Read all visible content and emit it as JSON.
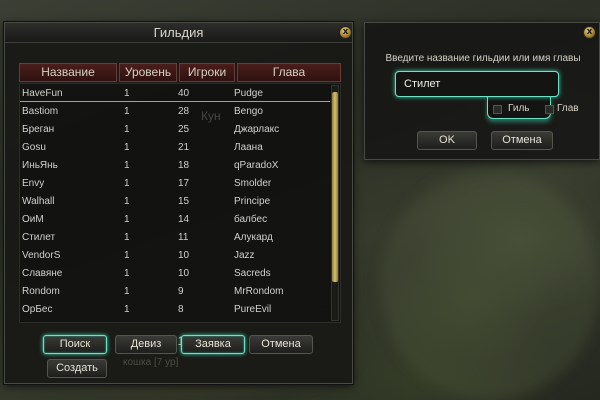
{
  "guild_window": {
    "title": "Гильдия",
    "close_label": "x",
    "columns": [
      "Название",
      "Уровень",
      "Игроки",
      "Глава"
    ],
    "rows": [
      {
        "name": "HaveFun",
        "level": "1",
        "players": "40",
        "leader": "Pudge"
      },
      {
        "name": "Bastiom",
        "level": "1",
        "players": "28",
        "leader": "Bengo"
      },
      {
        "name": "Бреган",
        "level": "1",
        "players": "25",
        "leader": "Джарлакс"
      },
      {
        "name": "Gosu",
        "level": "1",
        "players": "21",
        "leader": "Лаана"
      },
      {
        "name": "ИньЯнь",
        "level": "1",
        "players": "18",
        "leader": "qParadoX"
      },
      {
        "name": "Envy",
        "level": "1",
        "players": "17",
        "leader": "Smolder"
      },
      {
        "name": "Walhall",
        "level": "1",
        "players": "15",
        "leader": "Principe"
      },
      {
        "name": "ОиМ",
        "level": "1",
        "players": "14",
        "leader": "балбес"
      },
      {
        "name": "Стилет",
        "level": "1",
        "players": "11",
        "leader": "Алукард"
      },
      {
        "name": "VendorS",
        "level": "1",
        "players": "10",
        "leader": "Jazz"
      },
      {
        "name": "Славяне",
        "level": "1",
        "players": "10",
        "leader": "Sacreds"
      },
      {
        "name": "Rondom",
        "level": "1",
        "players": "9",
        "leader": "MrRondom"
      },
      {
        "name": "OpБec",
        "level": "1",
        "players": "8",
        "leader": "PureEvil"
      }
    ],
    "page": "1",
    "buttons": {
      "search": "Поиск",
      "motto": "Девиз",
      "apply": "Заявка",
      "cancel": "Отмена",
      "create": "Создать"
    },
    "background_text": {
      "top": "Кун",
      "bottom": "кошка [7 ур]"
    }
  },
  "search_dialog": {
    "close_label": "x",
    "prompt": "Введите название гильдии или имя главы",
    "input_value": "Стилет",
    "option_guild": "Гиль",
    "option_leader": "Глав",
    "ok": "OK",
    "cancel": "Отмена"
  },
  "colors": {
    "accent_glow": "#6ee2c4",
    "header_red": "#4a1e1b",
    "pager_green": "#8fbf3a",
    "scroll_gold": "#d8c06a"
  }
}
